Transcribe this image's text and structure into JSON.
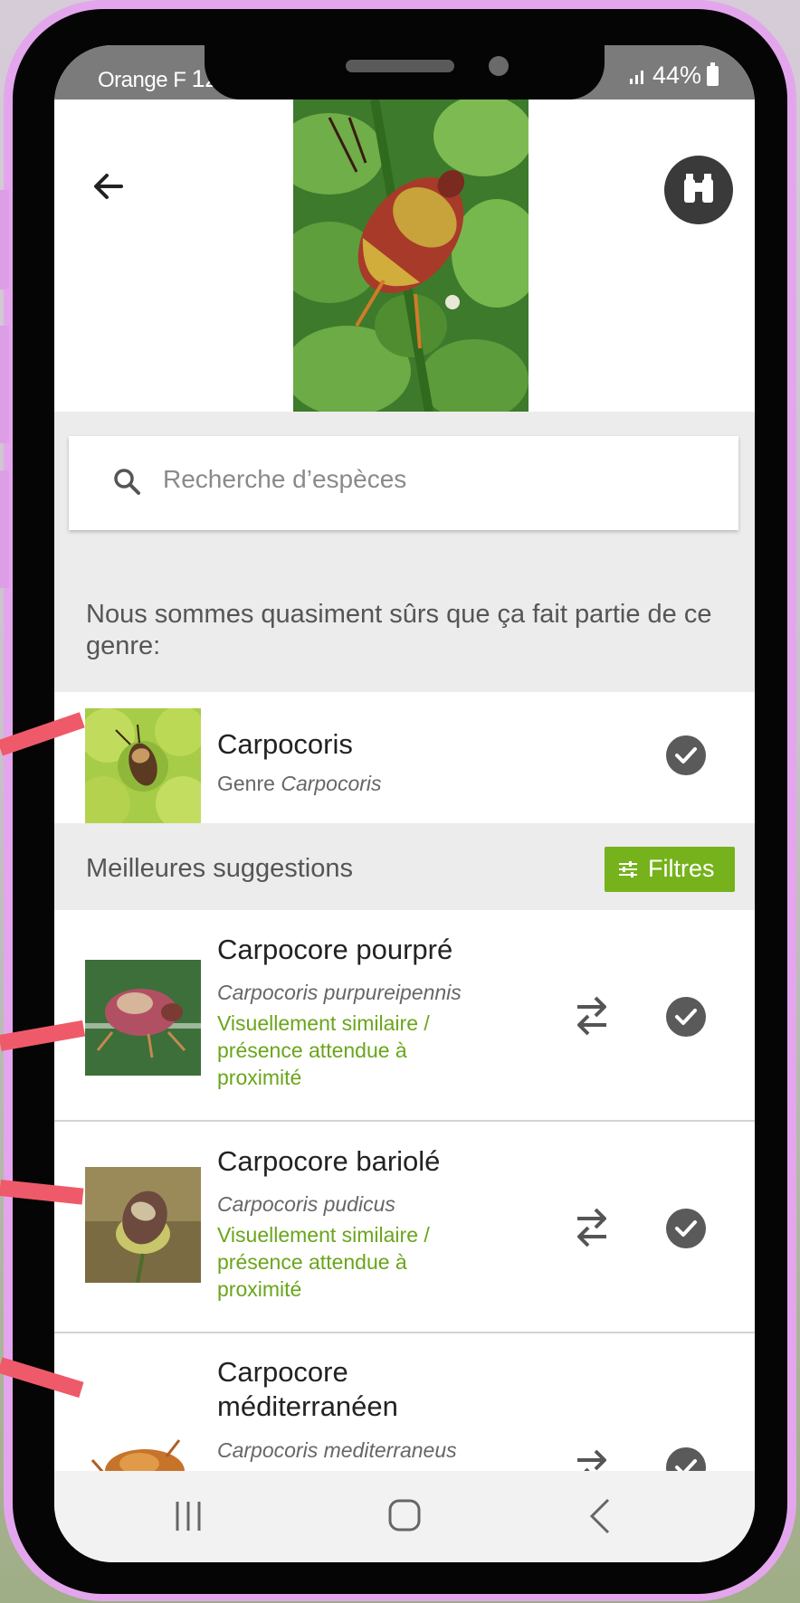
{
  "status_bar": {
    "carrier": "Orange F",
    "time_partial": "12",
    "battery": "44%"
  },
  "header": {
    "back_icon": "arrow-left-icon",
    "identify_icon": "binoculars-icon"
  },
  "search": {
    "placeholder": "Recherche d’espèces"
  },
  "genre_note": "Nous sommes quasiment sûrs que ça fait partie de ce genre:",
  "genre_result": {
    "name": "Carpocoris",
    "rank_prefix": "Genre",
    "rank_name": "Carpocoris"
  },
  "suggestions_header": {
    "label": "Meilleures suggestions",
    "filter_label": "Filtres"
  },
  "suggestions": [
    {
      "name": "Carpocore pourpré",
      "scientific": "Carpocoris purpureipennis",
      "hint": "Visuellement similaire / présence attendue à proximité"
    },
    {
      "name": "Carpocore bariolé",
      "scientific": "Carpocoris pudicus",
      "hint": "Visuellement similaire / présence attendue à proximité"
    },
    {
      "name": "Carpocore méditerranéen",
      "scientific": "Carpocoris mediterraneus",
      "hint": ""
    }
  ],
  "colors": {
    "accent_green": "#76b21b",
    "frame": "#e3a6ec",
    "annotation": "#ef5a6a"
  }
}
